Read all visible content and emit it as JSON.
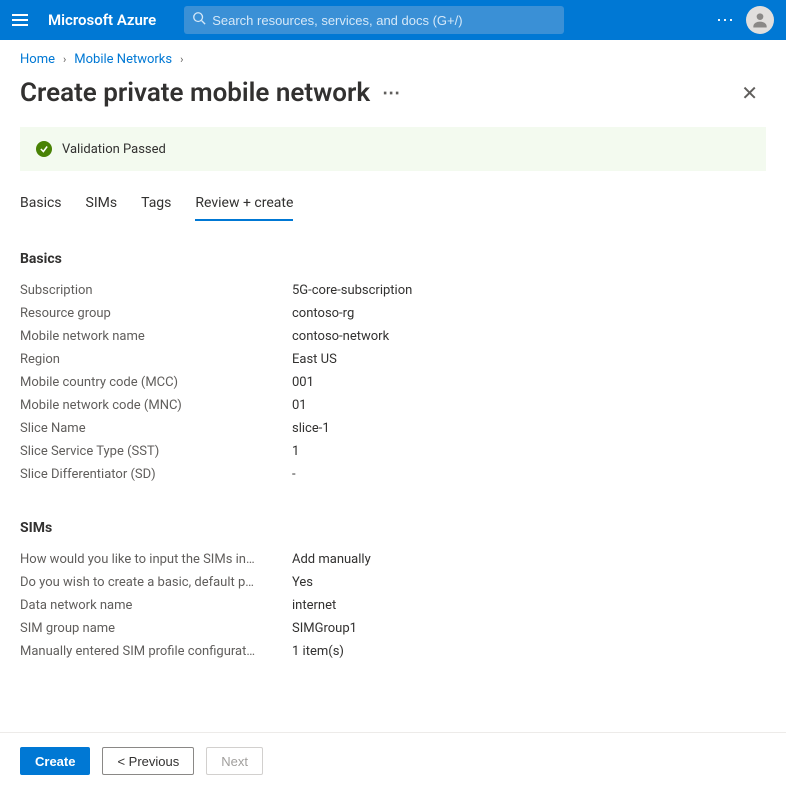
{
  "header": {
    "brand": "Microsoft Azure",
    "search_placeholder": "Search resources, services, and docs (G+/)"
  },
  "breadcrumb": {
    "items": [
      "Home",
      "Mobile Networks"
    ]
  },
  "page": {
    "title": "Create private mobile network"
  },
  "validation": {
    "message": "Validation Passed"
  },
  "tabs": {
    "items": [
      "Basics",
      "SIMs",
      "Tags",
      "Review + create"
    ],
    "active_index": 3
  },
  "sections": [
    {
      "title": "Basics",
      "rows": [
        {
          "key": "Subscription",
          "value": "5G-core-subscription"
        },
        {
          "key": "Resource group",
          "value": "contoso-rg"
        },
        {
          "key": "Mobile network name",
          "value": "contoso-network"
        },
        {
          "key": "Region",
          "value": "East US"
        },
        {
          "key": "Mobile country code (MCC)",
          "value": "001"
        },
        {
          "key": "Mobile network code (MNC)",
          "value": "01"
        },
        {
          "key": "Slice Name",
          "value": "slice-1"
        },
        {
          "key": "Slice Service Type (SST)",
          "value": "1"
        },
        {
          "key": "Slice Differentiator (SD)",
          "value": "-"
        }
      ]
    },
    {
      "title": "SIMs",
      "rows": [
        {
          "key": "How would you like to input the SIMs in…",
          "value": "Add manually"
        },
        {
          "key": "Do you wish to create a basic, default p…",
          "value": "Yes"
        },
        {
          "key": "Data network name",
          "value": "internet"
        },
        {
          "key": "SIM group name",
          "value": "SIMGroup1"
        },
        {
          "key": "Manually entered SIM profile configurat…",
          "value": "1 item(s)"
        }
      ]
    }
  ],
  "footer": {
    "create": "Create",
    "previous": "<  Previous",
    "next": "Next"
  }
}
